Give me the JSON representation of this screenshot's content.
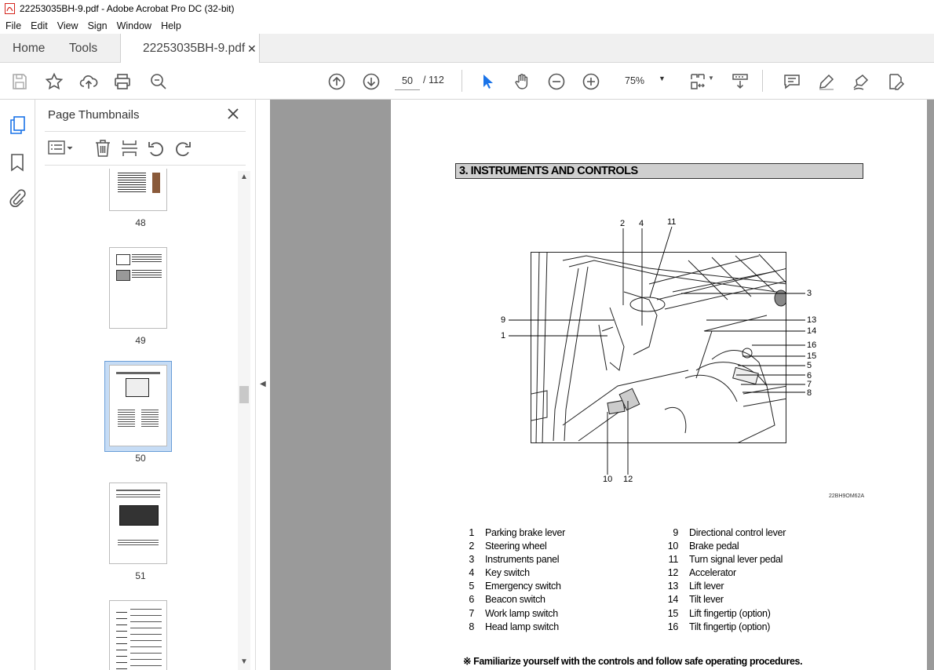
{
  "window": {
    "title": "22253035BH-9.pdf - Adobe Acrobat Pro DC (32-bit)"
  },
  "menu": [
    "File",
    "Edit",
    "View",
    "Sign",
    "Window",
    "Help"
  ],
  "tabs": {
    "home": "Home",
    "tools": "Tools",
    "document": "22253035BH-9.pdf"
  },
  "toolbar": {
    "current_page": "50",
    "page_total": "/ 112",
    "zoom": "75%"
  },
  "panel": {
    "title": "Page Thumbnails",
    "thumbnails": [
      {
        "label": "48"
      },
      {
        "label": "49"
      },
      {
        "label": "50",
        "selected": true
      },
      {
        "label": "51"
      },
      {
        "label": ""
      }
    ]
  },
  "document": {
    "heading": "3. INSTRUMENTS AND CONTROLS",
    "figure_code": "22BH9OM62A",
    "callouts": {
      "c2": "2",
      "c4": "4",
      "c11": "11",
      "c3": "3",
      "c9": "9",
      "c1": "1",
      "c13": "13",
      "c14": "14",
      "c16": "16",
      "c15": "15",
      "c5": "5",
      "c6": "6",
      "c7": "7",
      "c8": "8",
      "c10": "10",
      "c12": "12"
    },
    "legend_left": [
      {
        "num": "1",
        "text": "Parking brake lever"
      },
      {
        "num": "2",
        "text": "Steering wheel"
      },
      {
        "num": "3",
        "text": "Instruments panel"
      },
      {
        "num": "4",
        "text": "Key switch"
      },
      {
        "num": "5",
        "text": "Emergency switch"
      },
      {
        "num": "6",
        "text": "Beacon switch"
      },
      {
        "num": "7",
        "text": "Work lamp switch"
      },
      {
        "num": "8",
        "text": "Head lamp switch"
      }
    ],
    "legend_right": [
      {
        "num": "9",
        "text": "Directional control lever"
      },
      {
        "num": "10",
        "text": "Brake pedal"
      },
      {
        "num": "11",
        "text": "Turn signal lever pedal"
      },
      {
        "num": "12",
        "text": "Accelerator"
      },
      {
        "num": "13",
        "text": "Lift lever"
      },
      {
        "num": "14",
        "text": "Tilt lever"
      },
      {
        "num": "15",
        "text": "Lift fingertip (option)"
      },
      {
        "num": "16",
        "text": "Tilt fingertip (option)"
      }
    ],
    "note": "※ Familiarize yourself with the controls and follow safe operating procedures."
  },
  "colors": {
    "accent": "#1a73e8",
    "pdf_red": "#d4241c",
    "viewer_bg": "#9a9a9a"
  }
}
